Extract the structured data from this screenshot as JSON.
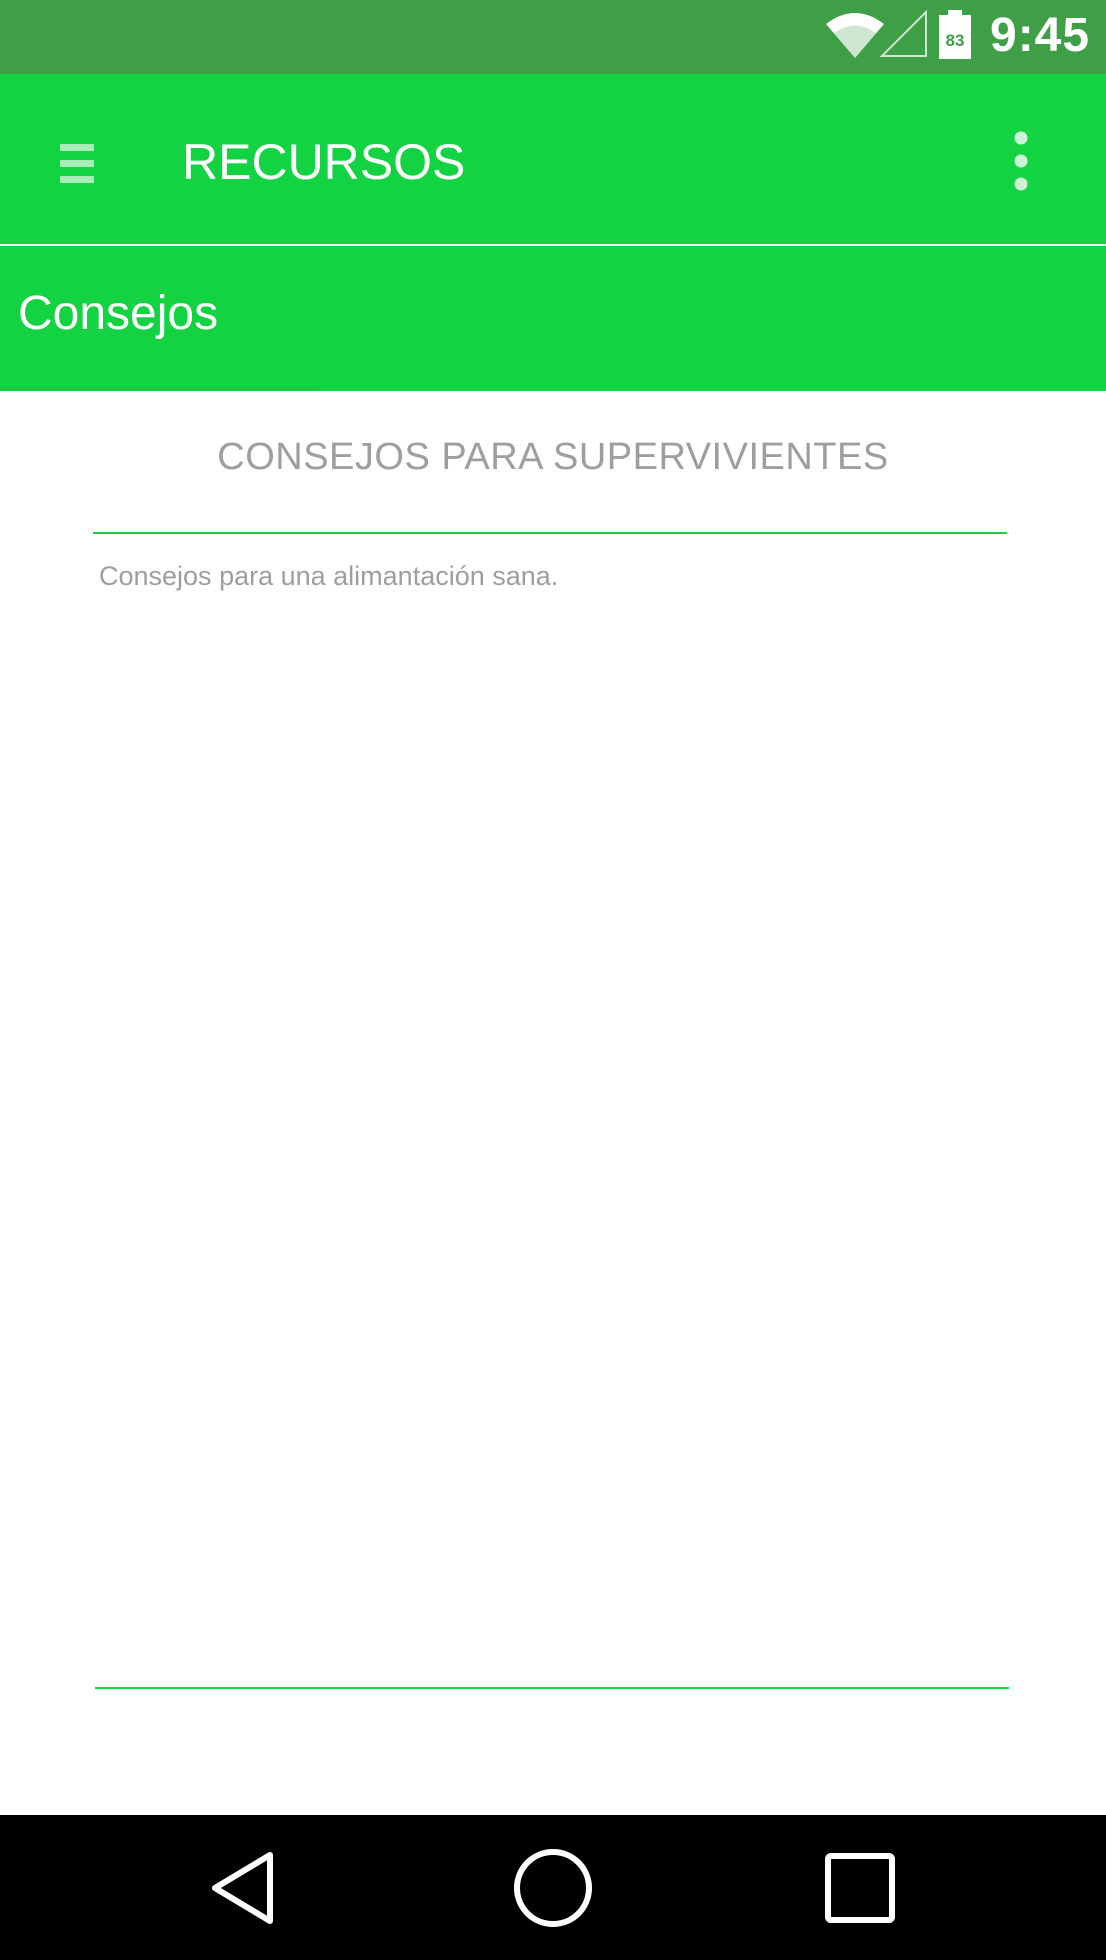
{
  "status_bar": {
    "time": "9:45",
    "battery_level": "83",
    "icons": [
      "wifi-icon",
      "cell-signal-icon",
      "battery-icon"
    ]
  },
  "app_bar": {
    "title": "RECURSOS",
    "menu_icon": "hamburger-menu-icon",
    "overflow_icon": "more-vert-icon"
  },
  "tabs": [
    {
      "label": "Consejos",
      "selected": true
    }
  ],
  "content": {
    "section_title": "CONSEJOS PARA SUPERVIVIENTES",
    "body": "Consejos para una alimantación sana."
  },
  "nav_bar": {
    "icons": [
      "back-icon",
      "home-icon",
      "recents-icon"
    ]
  },
  "colors": {
    "status_bar": "#3f9f47",
    "primary": "#13d342",
    "text_muted": "#9e9e9e",
    "nav_bar": "#000000"
  }
}
